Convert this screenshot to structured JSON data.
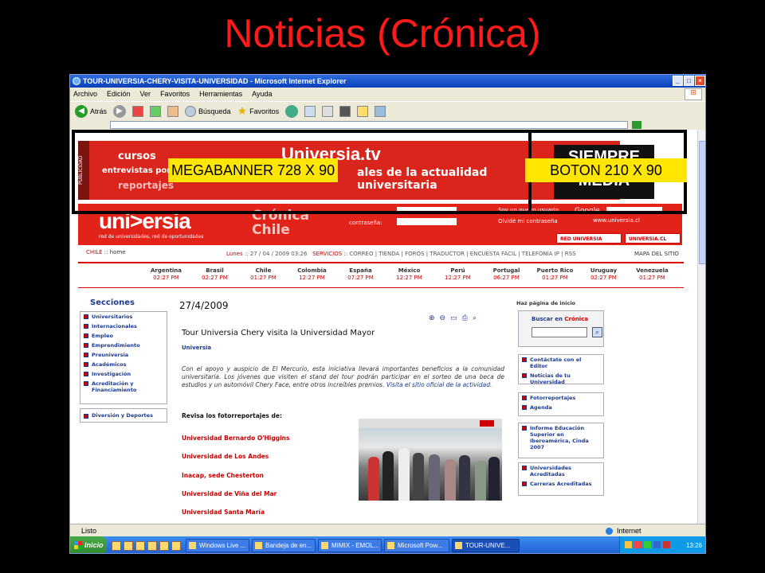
{
  "slide": {
    "title": "Noticias (Crónica)",
    "megabanner_label": "MEGABANNER 728 X 90",
    "boton_label": "BOTON 210 X 90"
  },
  "window": {
    "title": "TOUR-UNIVERSIA-CHERY-VISITA-UNIVERSIDAD - Microsoft Internet Explorer",
    "menu": [
      "Archivo",
      "Edición",
      "Ver",
      "Favoritos",
      "Herramientas",
      "Ayuda"
    ],
    "toolbar": {
      "back": "Atrás",
      "search": "Búsqueda",
      "favorites": "Favoritos"
    }
  },
  "ad": {
    "vertical": "PUBLICIDAD",
    "headline": "Universia.tv",
    "line1": "cursos",
    "line2": "entrevistas",
    "line2b": "pon",
    "line3": "reportajes",
    "right": [
      "ales de la actualidad",
      "universitaria"
    ],
    "boton_text": [
      "SIEMPRE",
      "MEDIA"
    ]
  },
  "header": {
    "logo": "uni>ersia",
    "tagline": "red de universidades, red de oportunidades",
    "section": "Crónica",
    "country": "Chile",
    "password_label": "contraseña:",
    "new_user": "Soy un nuevo usuario",
    "forgot": "Olvidé mi contraseña",
    "google": "Google",
    "web": "www.universia.cl",
    "tab1": "RED UNIVERSIA",
    "tab2": "UNIVERSIA.CL"
  },
  "crumb": {
    "country": "CHILE",
    "home": "home"
  },
  "dateline": {
    "day": "Lunes",
    "date": ":: 27 / 04 / 2009 03:26",
    "servicios": "SERVICIOS",
    "links": ":: CORREO | TIENDA | FOROS | TRADUCTOR | ENCUESTA FÁCIL | TELEFONÍA IP | RSS",
    "mapa": "MAPA DEL SITIO"
  },
  "clocks": [
    {
      "c": "Argentina",
      "t": "02:27 PM"
    },
    {
      "c": "Brasil",
      "t": "02:27 PM"
    },
    {
      "c": "Chile",
      "t": "01:27 PM"
    },
    {
      "c": "Colombia",
      "t": "12:27 PM"
    },
    {
      "c": "España",
      "t": "07:27 PM"
    },
    {
      "c": "México",
      "t": "12:27 PM"
    },
    {
      "c": "Perú",
      "t": "12:27 PM"
    },
    {
      "c": "Portugal",
      "t": "06:27 PM"
    },
    {
      "c": "Puerto Rico",
      "t": "01:27 PM"
    },
    {
      "c": "Uruguay",
      "t": "02:27 PM"
    },
    {
      "c": "Venezuela",
      "t": "01:27 PM"
    }
  ],
  "secciones": {
    "title": "Secciones",
    "items": [
      "Universitarios",
      "Internacionales",
      "Empleo",
      "Emprendimiento",
      "Preuniversia",
      "Académicos",
      "Investigación",
      "Acreditación y Financiamiento"
    ],
    "extra": "Diversión y Deportes"
  },
  "article": {
    "date": "27/4/2009",
    "title": "Tour Universia Chery visita la Universidad Mayor",
    "source": "Universia",
    "body": "Con el apoyo y auspicio de El Mercurio, esta iniciativa llevará importantes beneficios a la comunidad universitaria. Los jóvenes que visiten el stand del tour podrán participar en el sorteo de una beca de estudios y un automóvil Chery Face, entre otros increíbles premios.",
    "link": "Visita el sitio oficial de la actividad.",
    "revisa": "Revisa los fotorreportajes de:",
    "unis": [
      "Universidad Bernardo O'Higgins",
      "Universidad de Los Andes",
      "Inacap, sede Chesterton",
      "Universidad de Viña del Mar",
      "Universidad Santa María"
    ]
  },
  "right": {
    "home": "Haz página de inicio",
    "search_label": "Buscar en",
    "search_section": "Crónica",
    "box1": [
      "Contáctate con el Editor",
      "Noticias de tu Universidad"
    ],
    "box2": [
      "Fotorreportajes",
      "Agenda"
    ],
    "box3": [
      "Informe Educación Superior en Iberoamérica, Cinda 2007"
    ],
    "box4": [
      "Universidades Acreditadas",
      "Carreras Acreditadas"
    ]
  },
  "status": {
    "text": "Listo",
    "zone": "Internet"
  },
  "taskbar": {
    "start": "Inicio",
    "tasks": [
      "Windows Live ...",
      "Bandeja de en...",
      "MIMIX - EMOL...",
      "Microsoft Pow...",
      "TOUR-UNIVE..."
    ],
    "time": "13:26"
  }
}
